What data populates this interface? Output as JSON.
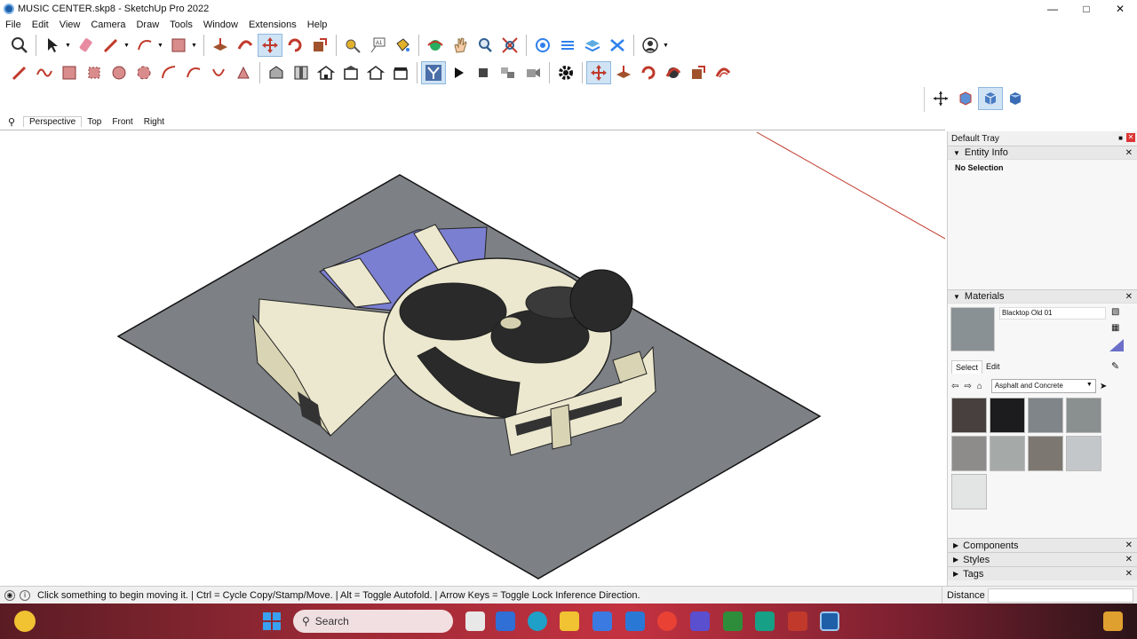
{
  "window": {
    "title": "MUSIC CENTER.skp8 - SketchUp Pro 2022"
  },
  "menu": [
    "File",
    "Edit",
    "View",
    "Camera",
    "Draw",
    "Tools",
    "Window",
    "Extensions",
    "Help"
  ],
  "scenes": {
    "tabs": [
      "Perspective",
      "Top",
      "Front",
      "Right"
    ]
  },
  "tray": {
    "title": "Default Tray",
    "entity_info": {
      "title": "Entity Info",
      "selection": "No Selection"
    },
    "materials": {
      "title": "Materials",
      "current": "Blacktop Old 01",
      "tabs": [
        "Select",
        "Edit"
      ],
      "library": "Asphalt and Concrete",
      "swatch_colors": [
        "#47403f",
        "#1c1c1e",
        "#7f8588",
        "#8a8f90",
        "#8e8c8a",
        "#a5aaa8",
        "#7d7771",
        "#c4c7ca",
        "#e3e4e4"
      ]
    },
    "collapsed": [
      "Components",
      "Styles",
      "Tags"
    ]
  },
  "status": {
    "message": "Click something to begin moving it. | Ctrl = Cycle Copy/Stamp/Move. | Alt = Toggle Autofold. | Arrow Keys = Toggle Lock Inference Direction.",
    "measure_label": "Distance"
  },
  "taskbar": {
    "search": "Search"
  },
  "colors": {
    "accent": "#1e5fa8",
    "ground": "#7d8185",
    "building": "#ece8cf",
    "seating": "#7b7fd1"
  }
}
